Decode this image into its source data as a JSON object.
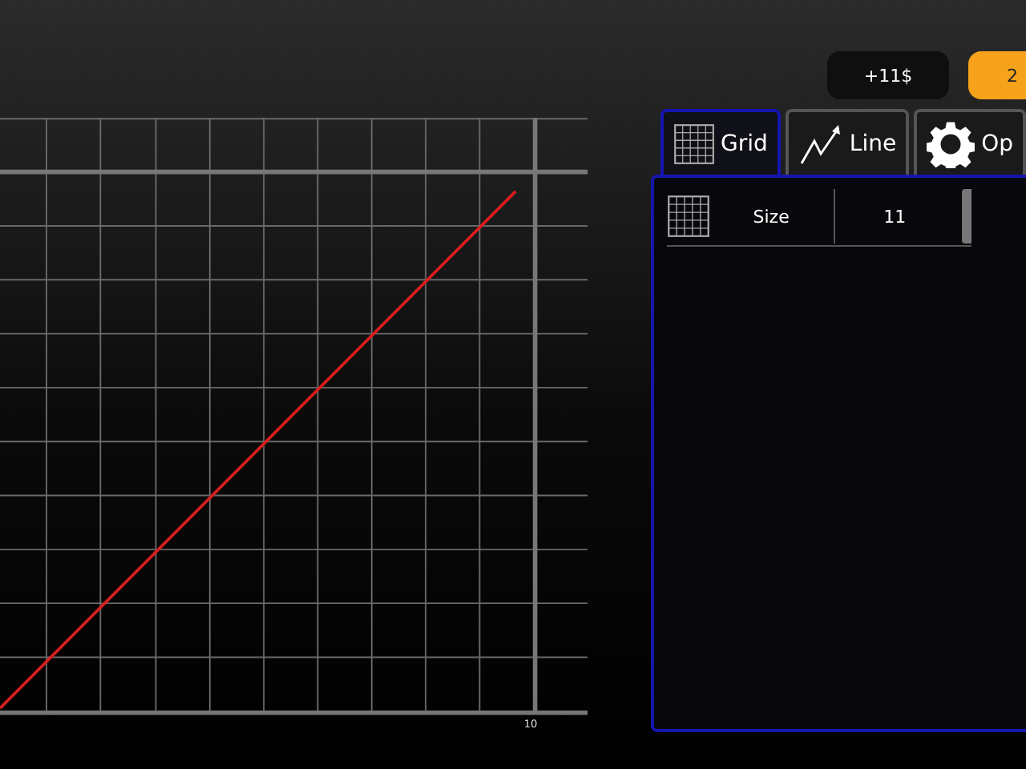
{
  "top_buttons": [
    {
      "label": "+11$",
      "kind": "dark"
    },
    {
      "label": "2",
      "kind": "orange"
    }
  ],
  "graph": {
    "tick_label": "10"
  },
  "tabs": [
    {
      "label": "Grid",
      "kind": "grid",
      "selected": true
    },
    {
      "label": "Line",
      "kind": "line",
      "selected": false
    },
    {
      "label": "Op",
      "kind": "gear",
      "selected": false
    }
  ],
  "settings": [
    {
      "label": "Size",
      "value": "11"
    }
  ]
}
